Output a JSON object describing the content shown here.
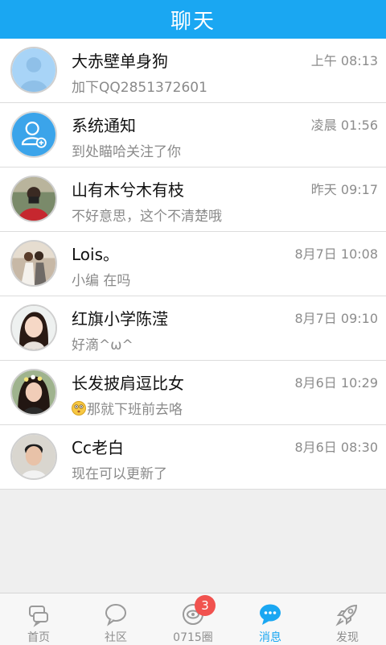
{
  "header": {
    "title": "聊天"
  },
  "conversations": [
    {
      "name": "大赤壁单身狗",
      "time": "上午 08:13",
      "message": "加下QQ2851372601",
      "avatar": "default-person"
    },
    {
      "name": "系统通知",
      "time": "凌晨 01:56",
      "message": "到处瞄哈关注了你",
      "avatar": "system-notify"
    },
    {
      "name": "山有木兮木有枝",
      "time": "昨天 09:17",
      "message": "不好意思，这个不清楚哦",
      "avatar": "photo"
    },
    {
      "name": "Lois。",
      "time": "8月7日 10:08",
      "message": "小编 在吗",
      "avatar": "photo"
    },
    {
      "name": "红旗小学陈滢",
      "time": "8月7日 09:10",
      "message": "好滴^ω^",
      "avatar": "photo"
    },
    {
      "name": "长发披肩逗比女",
      "time": "8月6日 10:29",
      "message": "那就下班前去咯",
      "avatar": "photo"
    },
    {
      "name": "Cc老白",
      "time": "8月6日 08:30",
      "message": "现在可以更新了",
      "avatar": "photo"
    }
  ],
  "tabbar": {
    "tabs": [
      {
        "label": "首页",
        "icon": "home-chat-icon"
      },
      {
        "label": "社区",
        "icon": "speech-bubble-icon"
      },
      {
        "label": "0715圈",
        "icon": "eye-circle-icon",
        "badge": "3"
      },
      {
        "label": "消息",
        "icon": "message-icon",
        "active": true
      },
      {
        "label": "发现",
        "icon": "rocket-icon"
      }
    ]
  },
  "colors": {
    "accent": "#1aa7f2",
    "badge": "#f1524f"
  }
}
